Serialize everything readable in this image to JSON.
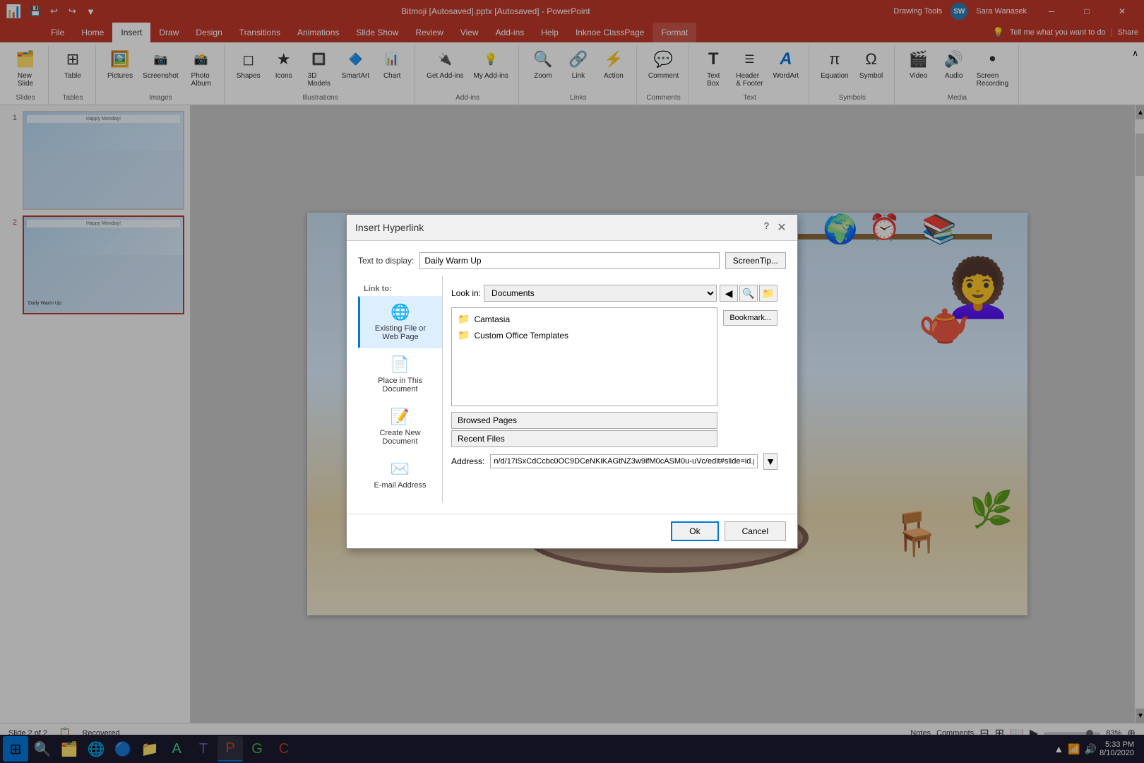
{
  "titlebar": {
    "title": "Bitmoji [Autosaved].pptx [Autosaved] - PowerPoint",
    "drawing_tools_label": "Drawing Tools",
    "user": "Sara Wanasek",
    "user_initials": "SW",
    "minimize": "─",
    "maximize": "□",
    "close": "✕"
  },
  "quick_access": {
    "save": "💾",
    "undo": "↩",
    "redo": "↪",
    "more": "▼"
  },
  "ribbon": {
    "tabs": [
      "File",
      "Home",
      "Insert",
      "Draw",
      "Design",
      "Transitions",
      "Animations",
      "Slide Show",
      "Review",
      "View",
      "Add-ins",
      "Help",
      "Inknoe ClassPage",
      "Format"
    ],
    "active_tab": "Insert",
    "drawing_tools_tab": "Format",
    "groups": [
      {
        "label": "Slides",
        "items": [
          {
            "icon": "🗂️",
            "label": "New\nSlide",
            "name": "new-slide-btn"
          },
          {
            "icon": "⊞",
            "label": "Table",
            "name": "table-btn"
          }
        ]
      },
      {
        "label": "Images",
        "items": [
          {
            "icon": "🖼️",
            "label": "Pictures",
            "name": "pictures-btn"
          },
          {
            "icon": "📷",
            "label": "Screenshot",
            "name": "screenshot-btn"
          },
          {
            "icon": "📸",
            "label": "Photo\nAlbum",
            "name": "photo-album-btn"
          }
        ]
      },
      {
        "label": "Illustrations",
        "items": [
          {
            "icon": "◻",
            "label": "Shapes",
            "name": "shapes-btn"
          },
          {
            "icon": "★",
            "label": "Icons",
            "name": "icons-btn"
          },
          {
            "icon": "🔲",
            "label": "3D\nModels",
            "name": "3d-models-btn"
          },
          {
            "icon": "🔷",
            "label": "SmartArt",
            "name": "smartart-btn"
          },
          {
            "icon": "📊",
            "label": "Chart",
            "name": "chart-btn"
          }
        ]
      },
      {
        "label": "Add-ins",
        "items": [
          {
            "icon": "🔌",
            "label": "Get Add-ins",
            "name": "get-addins-btn"
          },
          {
            "icon": "💡",
            "label": "My Add-ins",
            "name": "my-addins-btn"
          }
        ]
      },
      {
        "label": "Links",
        "items": [
          {
            "icon": "🔍",
            "label": "Zoom",
            "name": "zoom-btn"
          },
          {
            "icon": "🔗",
            "label": "Link",
            "name": "link-btn"
          },
          {
            "icon": "⚡",
            "label": "Action",
            "name": "action-btn"
          }
        ]
      },
      {
        "label": "Comments",
        "items": [
          {
            "icon": "💬",
            "label": "Comment",
            "name": "comment-btn"
          }
        ]
      },
      {
        "label": "Text",
        "items": [
          {
            "icon": "T",
            "label": "Text\nBox",
            "name": "textbox-btn"
          },
          {
            "icon": "Ⅲ",
            "label": "Header\n& Footer",
            "name": "header-footer-btn"
          },
          {
            "icon": "A",
            "label": "WordArt",
            "name": "wordart-btn"
          }
        ]
      },
      {
        "label": "Symbols",
        "items": [
          {
            "icon": "π",
            "label": "Equation",
            "name": "equation-btn"
          },
          {
            "icon": "Ω",
            "label": "Symbol",
            "name": "symbol-btn"
          }
        ]
      },
      {
        "label": "Media",
        "items": [
          {
            "icon": "🎬",
            "label": "Video",
            "name": "video-btn"
          },
          {
            "icon": "🔊",
            "label": "Audio",
            "name": "audio-btn"
          },
          {
            "icon": "⏺",
            "label": "Screen\nRecording",
            "name": "screen-recording-btn"
          }
        ]
      }
    ],
    "tell_me": "Tell me what you want to do",
    "share": "Share"
  },
  "slides": [
    {
      "num": 1,
      "selected": false
    },
    {
      "num": 2,
      "selected": true
    }
  ],
  "status_bar": {
    "slide_info": "Slide 2 of 2",
    "recovered": "Recovered",
    "notes": "Notes",
    "comments": "Comments",
    "zoom": "83%",
    "time": "5:33 PM",
    "date": "8/10/2020"
  },
  "dialog": {
    "title": "Insert Hyperlink",
    "help_btn": "?",
    "close_btn": "✕",
    "text_to_display_label": "Text to display:",
    "text_to_display_value": "Daily Warm Up",
    "screentip_btn": "ScreenTip...",
    "look_in_label": "Look in:",
    "look_in_value": "Documents",
    "link_options": [
      {
        "label": "Existing File or\nWeb Page",
        "icon": "🌐",
        "selected": true
      },
      {
        "label": "Place in This\nDocument",
        "icon": "📄",
        "selected": false
      },
      {
        "label": "Create New\nDocument",
        "icon": "📝",
        "selected": false
      },
      {
        "label": "E-mail Address",
        "icon": "✉️",
        "selected": false
      }
    ],
    "files": [
      {
        "name": "Camtasia",
        "icon": "📁"
      },
      {
        "name": "Custom Office Templates",
        "icon": "📁"
      }
    ],
    "sidebar_buttons": [
      {
        "label": "Bookmark...",
        "name": "bookmark-btn"
      }
    ],
    "address_label": "Address:",
    "address_value": "n/d/17iSxCdCcbc0OC9DCeNKiKAGtNZ3w9ifM0cASM0u-uVc/edit#slide=id.p",
    "ok_btn": "Ok",
    "cancel_btn": "Cancel"
  },
  "taskbar": {
    "time": "5:33 PM",
    "date": "8/10/2020",
    "apps": [
      {
        "icon": "⊞",
        "name": "start-btn",
        "color": "#0078d7"
      },
      {
        "icon": "🔍",
        "name": "search-btn"
      },
      {
        "icon": "🖂",
        "name": "mail-btn"
      },
      {
        "icon": "🌐",
        "name": "edge-btn",
        "color": "#0078d7"
      },
      {
        "icon": "C",
        "name": "chrome-btn",
        "color": "#4CAF50"
      },
      {
        "icon": "🗂️",
        "name": "explorer-btn"
      },
      {
        "icon": "A",
        "name": "android-btn",
        "color": "#3ddc84"
      },
      {
        "icon": "T",
        "name": "teams-btn",
        "color": "#6264a7"
      },
      {
        "icon": "P",
        "name": "powerpoint-btn",
        "color": "#d04520",
        "active": true
      },
      {
        "icon": "G",
        "name": "greenshot-btn",
        "color": "#4CAF50"
      },
      {
        "icon": "C",
        "name": "camtasia-btn",
        "color": "#c0392b"
      }
    ]
  }
}
